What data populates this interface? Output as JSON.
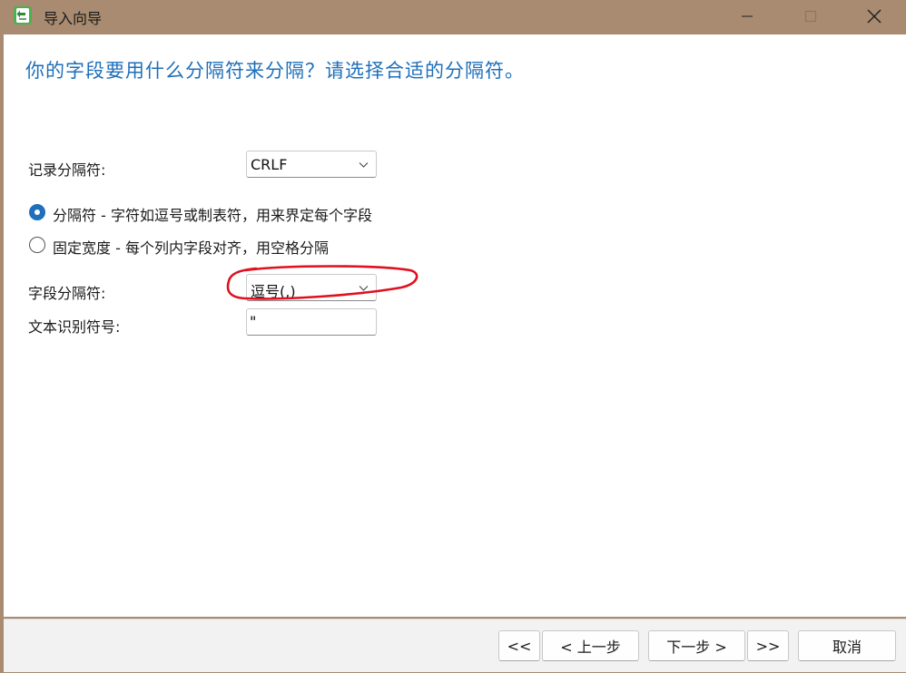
{
  "window": {
    "title": "导入向导",
    "app_icon": "import-icon",
    "controls": [
      "minimize-icon",
      "maximize-icon",
      "close-icon"
    ]
  },
  "page": {
    "heading": "你的字段要用什么分隔符来分隔？请选择合适的分隔符。"
  },
  "record_separator": {
    "label": "记录分隔符:",
    "value": "CRLF"
  },
  "mode": {
    "options": [
      {
        "label": "分隔符 - 字符如逗号或制表符，用来界定每个字段",
        "selected": true
      },
      {
        "label": "固定宽度 - 每个列内字段对齐，用空格分隔",
        "selected": false
      }
    ]
  },
  "field_separator": {
    "label": "字段分隔符:",
    "value": "逗号(,)"
  },
  "text_qualifier": {
    "label": "文本识别符号:",
    "value": "\""
  },
  "footer": {
    "first_label": "<<",
    "prev_label": "< 上一步",
    "next_label": "下一步 >",
    "last_label": ">>",
    "cancel_label": "取消"
  },
  "colors": {
    "accent": "#1f6fbd",
    "heading": "#1e6fba",
    "titlebar": "#a88b70",
    "annotation": "#e0101e"
  }
}
